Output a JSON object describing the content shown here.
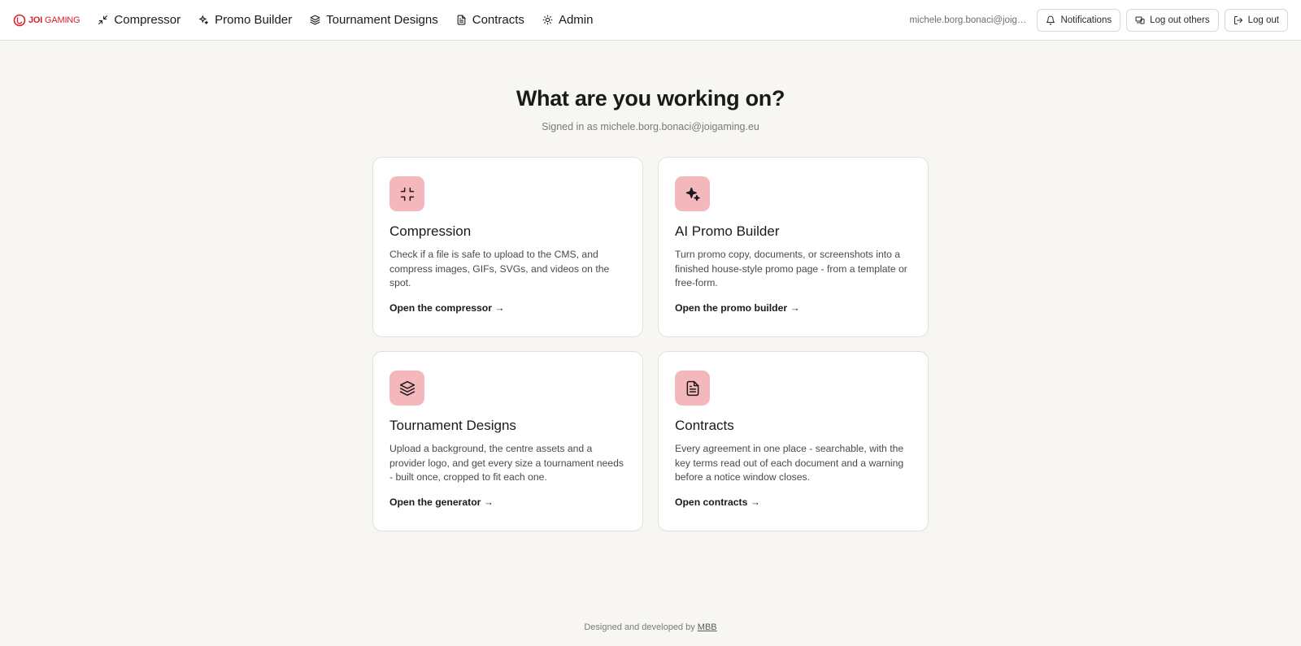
{
  "brand": {
    "logo_text_bold": "JOI",
    "logo_text": "GAMING",
    "color": "#d8232a"
  },
  "nav": {
    "items": [
      {
        "label": "Compressor",
        "icon": "shrink-icon"
      },
      {
        "label": "Promo Builder",
        "icon": "sparkles-icon"
      },
      {
        "label": "Tournament Designs",
        "icon": "layers-icon"
      },
      {
        "label": "Contracts",
        "icon": "document-icon"
      },
      {
        "label": "Admin",
        "icon": "sun-icon"
      }
    ]
  },
  "header": {
    "user_email": "michele.borg.bonaci@joigaming.eu",
    "notifications_label": "Notifications",
    "log_out_others_label": "Log out others",
    "log_out_label": "Log out"
  },
  "hero": {
    "title": "What are you working on?",
    "subtitle": "Signed in as michele.borg.bonaci@joigaming.eu"
  },
  "cards": [
    {
      "title": "Compression",
      "description": "Check if a file is safe to upload to the CMS, and compress images, GIFs, SVGs, and videos on the spot.",
      "link": "Open the compressor →",
      "icon": "shrink-icon"
    },
    {
      "title": "AI Promo Builder",
      "description": "Turn promo copy, documents, or screenshots into a finished house-style promo page - from a template or free-form.",
      "link": "Open the promo builder →",
      "icon": "sparkles-icon"
    },
    {
      "title": "Tournament Designs",
      "description": "Upload a background, the centre assets and a provider logo, and get every size a tournament needs - built once, cropped to fit each one.",
      "link": "Open the generator →",
      "icon": "layers-icon"
    },
    {
      "title": "Contracts",
      "description": "Every agreement in one place - searchable, with the key terms read out of each document and a warning before a notice window closes.",
      "link": "Open contracts →",
      "icon": "document-icon"
    }
  ],
  "accent_color": "#f4b8bc",
  "footer": {
    "text": "Designed and developed by",
    "link": "MBB"
  }
}
